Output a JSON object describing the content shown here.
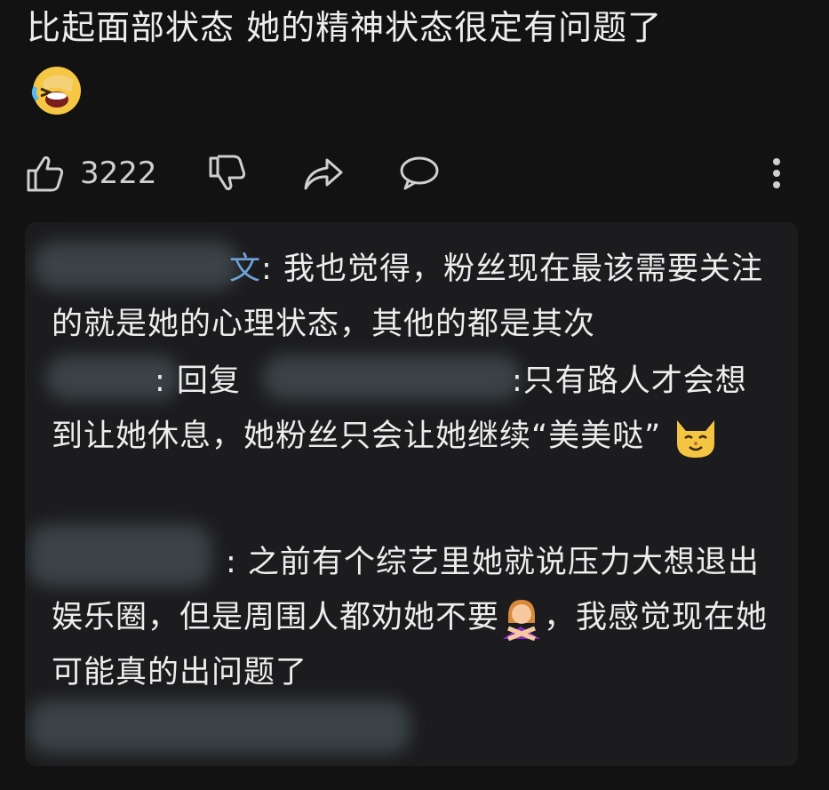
{
  "post": {
    "text": "比起面部状态 她的精神状态很定有问题了",
    "emoji": "grinning-squinting-face-emoji"
  },
  "actions": {
    "like_count": "3222"
  },
  "replies": [
    {
      "username_visible_suffix": "文",
      "separator": ": ",
      "text": "我也觉得，粉丝现在最该需要关注的就是她的心理状态，其他的都是其次"
    },
    {
      "separator": ": ",
      "reply_prefix": "回复",
      "text_after_mention": ":只有路人才会想到让她休息，她粉丝只会让她继续“美美哒”",
      "emoji": "cat-face-emoji"
    },
    {
      "separator": ": ",
      "text_part1": "之前有个综艺里她就说压力大想退出娱乐圈，但是周围人都劝她不要",
      "emoji": "person-gesturing-no-emoji",
      "text_part2": "，我感觉现在她可能真的出问题了"
    }
  ]
}
